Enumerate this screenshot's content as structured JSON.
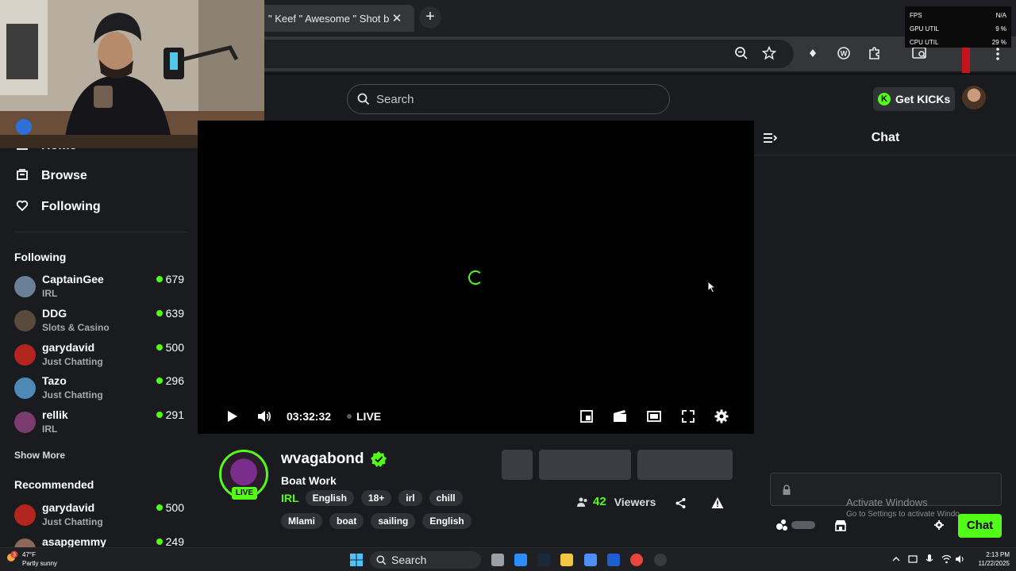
{
  "browser": {
    "tab_title": "\" Keef \" Awesome \" Shot by",
    "tab_close": "✕",
    "new_tab": "+"
  },
  "perf_overlay": {
    "rows": [
      {
        "label": "FPS",
        "value": "N/A"
      },
      {
        "label": "GPU UTIL",
        "value": "9 %"
      },
      {
        "label": "CPU UTIL",
        "value": "29 %"
      }
    ]
  },
  "header": {
    "search_placeholder": "Search",
    "get_kicks": "Get KICKs",
    "kicks_icon": "K"
  },
  "sidebar": {
    "nav": [
      {
        "label": "Home",
        "icon": "home-icon"
      },
      {
        "label": "Browse",
        "icon": "browse-icon"
      },
      {
        "label": "Following",
        "icon": "heart-icon"
      }
    ],
    "following_title": "Following",
    "following": [
      {
        "name": "CaptainGee",
        "category": "IRL",
        "viewers": "679",
        "color": "#6b7f99"
      },
      {
        "name": "DDG",
        "category": "Slots & Casino",
        "viewers": "639",
        "color": "#5a4a3e"
      },
      {
        "name": "garydavid",
        "category": "Just Chatting",
        "viewers": "500",
        "color": "#b3261e"
      },
      {
        "name": "Tazo",
        "category": "Just Chatting",
        "viewers": "296",
        "color": "#4f89b8"
      },
      {
        "name": "rellik",
        "category": "IRL",
        "viewers": "291",
        "color": "#7b3b6f"
      }
    ],
    "show_more": "Show More",
    "recommended_title": "Recommended",
    "recommended": [
      {
        "name": "garydavid",
        "category": "Just Chatting",
        "viewers": "500",
        "color": "#b3261e"
      },
      {
        "name": "asapgemmy",
        "category": "",
        "viewers": "249",
        "color": "#8a6a54"
      }
    ]
  },
  "player": {
    "time": "03:32:32",
    "live_label": "LIVE"
  },
  "stream": {
    "live_badge": "LIVE",
    "streamer": "wvagabond",
    "title": "Boat Work",
    "category": "IRL",
    "tags_row1": [
      "English",
      "18+",
      "irl",
      "chill"
    ],
    "tags_row2": [
      "Mlami",
      "boat",
      "sailing",
      "English"
    ],
    "viewer_count": "42",
    "viewers_label": "Viewers"
  },
  "chat": {
    "title": "Chat",
    "send_label": "Chat",
    "activate_title": "Activate Windows",
    "activate_sub": "Go to Settings to activate Windo"
  },
  "taskbar": {
    "weather_temp": "47°F",
    "weather_desc": "Partly sunny",
    "weather_badge": "3",
    "search": "Search",
    "time": "2:13 PM",
    "date": "11/22/2025"
  },
  "colors": {
    "accent": "#53fc18",
    "background": "#191b1f",
    "player": "#000000"
  }
}
